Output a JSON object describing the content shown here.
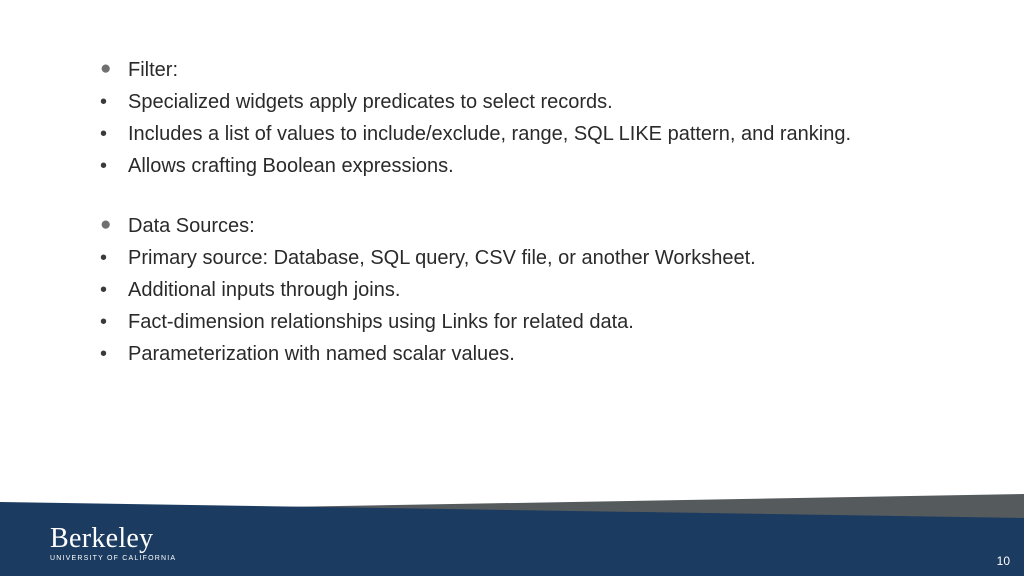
{
  "groups": [
    {
      "header": "Filter:",
      "items": [
        "Specialized widgets apply predicates to select records.",
        "Includes a list of values to include/exclude, range, SQL LIKE pattern, and ranking.",
        "Allows crafting Boolean expressions."
      ]
    },
    {
      "header": "Data Sources:",
      "items": [
        "Primary source: Database, SQL query, CSV file, or another Worksheet.",
        "Additional inputs through joins.",
        "Fact-dimension relationships using Links for related data.",
        "Parameterization with named scalar values."
      ]
    }
  ],
  "footer": {
    "logo_main": "Berkeley",
    "logo_sub": "UNIVERSITY OF CALIFORNIA",
    "page_number": "10"
  }
}
